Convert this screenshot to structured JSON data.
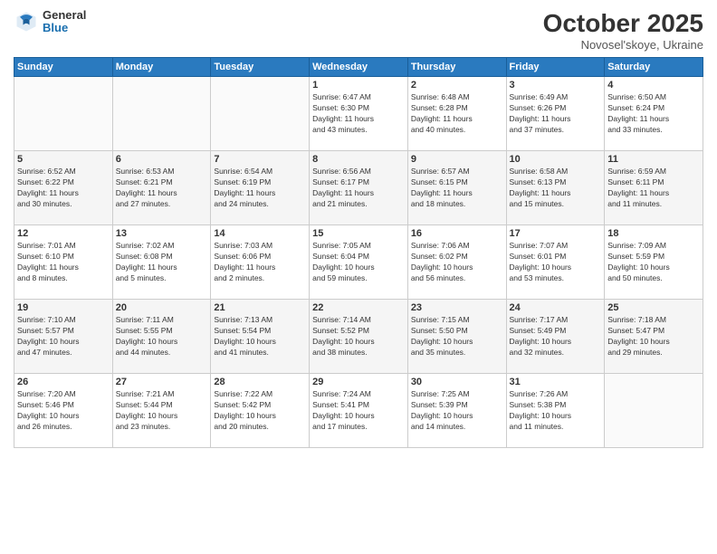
{
  "header": {
    "logo": {
      "general": "General",
      "blue": "Blue"
    },
    "title": "October 2025",
    "location": "Novosel'skoye, Ukraine"
  },
  "weekdays": [
    "Sunday",
    "Monday",
    "Tuesday",
    "Wednesday",
    "Thursday",
    "Friday",
    "Saturday"
  ],
  "weeks": [
    [
      {
        "day": "",
        "info": ""
      },
      {
        "day": "",
        "info": ""
      },
      {
        "day": "",
        "info": ""
      },
      {
        "day": "1",
        "info": "Sunrise: 6:47 AM\nSunset: 6:30 PM\nDaylight: 11 hours\nand 43 minutes."
      },
      {
        "day": "2",
        "info": "Sunrise: 6:48 AM\nSunset: 6:28 PM\nDaylight: 11 hours\nand 40 minutes."
      },
      {
        "day": "3",
        "info": "Sunrise: 6:49 AM\nSunset: 6:26 PM\nDaylight: 11 hours\nand 37 minutes."
      },
      {
        "day": "4",
        "info": "Sunrise: 6:50 AM\nSunset: 6:24 PM\nDaylight: 11 hours\nand 33 minutes."
      }
    ],
    [
      {
        "day": "5",
        "info": "Sunrise: 6:52 AM\nSunset: 6:22 PM\nDaylight: 11 hours\nand 30 minutes."
      },
      {
        "day": "6",
        "info": "Sunrise: 6:53 AM\nSunset: 6:21 PM\nDaylight: 11 hours\nand 27 minutes."
      },
      {
        "day": "7",
        "info": "Sunrise: 6:54 AM\nSunset: 6:19 PM\nDaylight: 11 hours\nand 24 minutes."
      },
      {
        "day": "8",
        "info": "Sunrise: 6:56 AM\nSunset: 6:17 PM\nDaylight: 11 hours\nand 21 minutes."
      },
      {
        "day": "9",
        "info": "Sunrise: 6:57 AM\nSunset: 6:15 PM\nDaylight: 11 hours\nand 18 minutes."
      },
      {
        "day": "10",
        "info": "Sunrise: 6:58 AM\nSunset: 6:13 PM\nDaylight: 11 hours\nand 15 minutes."
      },
      {
        "day": "11",
        "info": "Sunrise: 6:59 AM\nSunset: 6:11 PM\nDaylight: 11 hours\nand 11 minutes."
      }
    ],
    [
      {
        "day": "12",
        "info": "Sunrise: 7:01 AM\nSunset: 6:10 PM\nDaylight: 11 hours\nand 8 minutes."
      },
      {
        "day": "13",
        "info": "Sunrise: 7:02 AM\nSunset: 6:08 PM\nDaylight: 11 hours\nand 5 minutes."
      },
      {
        "day": "14",
        "info": "Sunrise: 7:03 AM\nSunset: 6:06 PM\nDaylight: 11 hours\nand 2 minutes."
      },
      {
        "day": "15",
        "info": "Sunrise: 7:05 AM\nSunset: 6:04 PM\nDaylight: 10 hours\nand 59 minutes."
      },
      {
        "day": "16",
        "info": "Sunrise: 7:06 AM\nSunset: 6:02 PM\nDaylight: 10 hours\nand 56 minutes."
      },
      {
        "day": "17",
        "info": "Sunrise: 7:07 AM\nSunset: 6:01 PM\nDaylight: 10 hours\nand 53 minutes."
      },
      {
        "day": "18",
        "info": "Sunrise: 7:09 AM\nSunset: 5:59 PM\nDaylight: 10 hours\nand 50 minutes."
      }
    ],
    [
      {
        "day": "19",
        "info": "Sunrise: 7:10 AM\nSunset: 5:57 PM\nDaylight: 10 hours\nand 47 minutes."
      },
      {
        "day": "20",
        "info": "Sunrise: 7:11 AM\nSunset: 5:55 PM\nDaylight: 10 hours\nand 44 minutes."
      },
      {
        "day": "21",
        "info": "Sunrise: 7:13 AM\nSunset: 5:54 PM\nDaylight: 10 hours\nand 41 minutes."
      },
      {
        "day": "22",
        "info": "Sunrise: 7:14 AM\nSunset: 5:52 PM\nDaylight: 10 hours\nand 38 minutes."
      },
      {
        "day": "23",
        "info": "Sunrise: 7:15 AM\nSunset: 5:50 PM\nDaylight: 10 hours\nand 35 minutes."
      },
      {
        "day": "24",
        "info": "Sunrise: 7:17 AM\nSunset: 5:49 PM\nDaylight: 10 hours\nand 32 minutes."
      },
      {
        "day": "25",
        "info": "Sunrise: 7:18 AM\nSunset: 5:47 PM\nDaylight: 10 hours\nand 29 minutes."
      }
    ],
    [
      {
        "day": "26",
        "info": "Sunrise: 7:20 AM\nSunset: 5:46 PM\nDaylight: 10 hours\nand 26 minutes."
      },
      {
        "day": "27",
        "info": "Sunrise: 7:21 AM\nSunset: 5:44 PM\nDaylight: 10 hours\nand 23 minutes."
      },
      {
        "day": "28",
        "info": "Sunrise: 7:22 AM\nSunset: 5:42 PM\nDaylight: 10 hours\nand 20 minutes."
      },
      {
        "day": "29",
        "info": "Sunrise: 7:24 AM\nSunset: 5:41 PM\nDaylight: 10 hours\nand 17 minutes."
      },
      {
        "day": "30",
        "info": "Sunrise: 7:25 AM\nSunset: 5:39 PM\nDaylight: 10 hours\nand 14 minutes."
      },
      {
        "day": "31",
        "info": "Sunrise: 7:26 AM\nSunset: 5:38 PM\nDaylight: 10 hours\nand 11 minutes."
      },
      {
        "day": "",
        "info": ""
      }
    ]
  ]
}
